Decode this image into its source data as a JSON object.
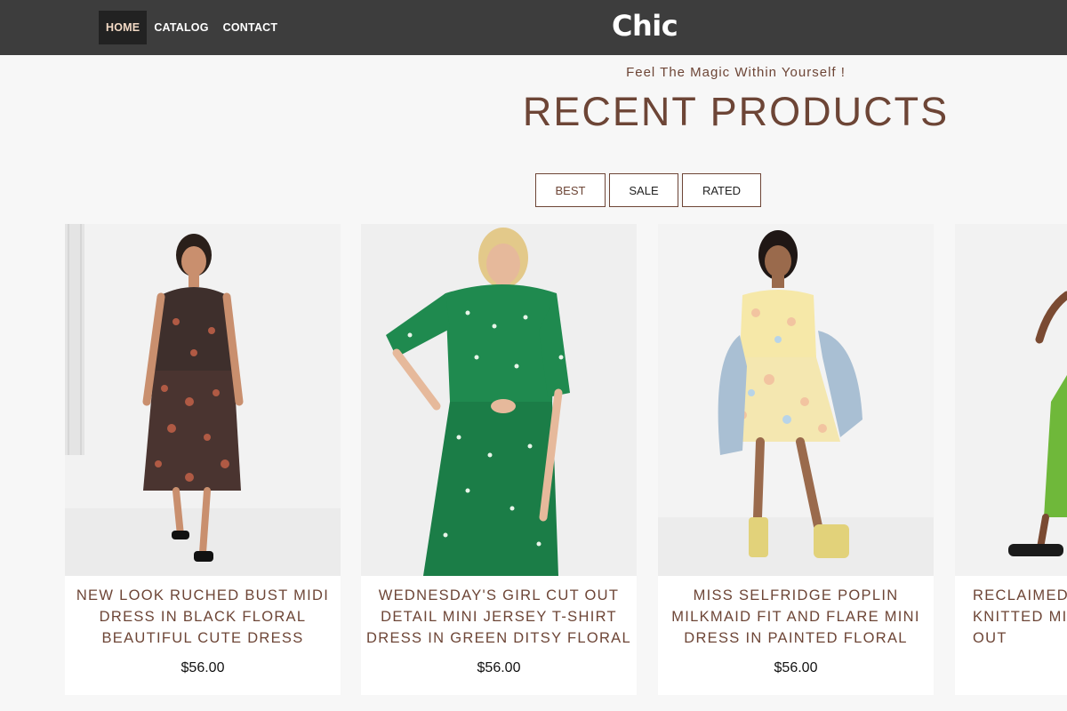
{
  "nav": {
    "items": [
      "HOME",
      "CATALOG",
      "CONTACT"
    ],
    "active": "HOME"
  },
  "logo": "Chic",
  "tagline": "Feel The Magic Within Yourself !",
  "heading": "RECENT PRODUCTS",
  "filters": [
    "BEST",
    "SALE",
    "RATED"
  ],
  "products": [
    {
      "title": "NEW LOOK RUCHED BUST MIDI DRESS IN BLACK FLORAL BEAUTIFUL CUTE DRESS",
      "price": "$56.00",
      "image": "model-black-floral-midi-dress"
    },
    {
      "title": "WEDNESDAY'S GIRL CUT OUT DETAIL MINI JERSEY T-SHIRT DRESS IN GREEN DITSY FLORAL",
      "price": "$56.00",
      "image": "model-green-ditsy-floral-dress"
    },
    {
      "title": "MISS SELFRIDGE POPLIN MILKMAID FIT AND FLARE MINI DRESS IN PAINTED FLORAL",
      "price": "$56.00",
      "image": "model-yellow-floral-mini-dress"
    },
    {
      "title": "RECLAIMED KNITTED MID OUT",
      "price": "",
      "image": "model-green-knitted-dress"
    }
  ],
  "colors": {
    "topbar": "#3d3d3d",
    "accent": "#6d4536",
    "page_bg": "#f7f7f7"
  }
}
